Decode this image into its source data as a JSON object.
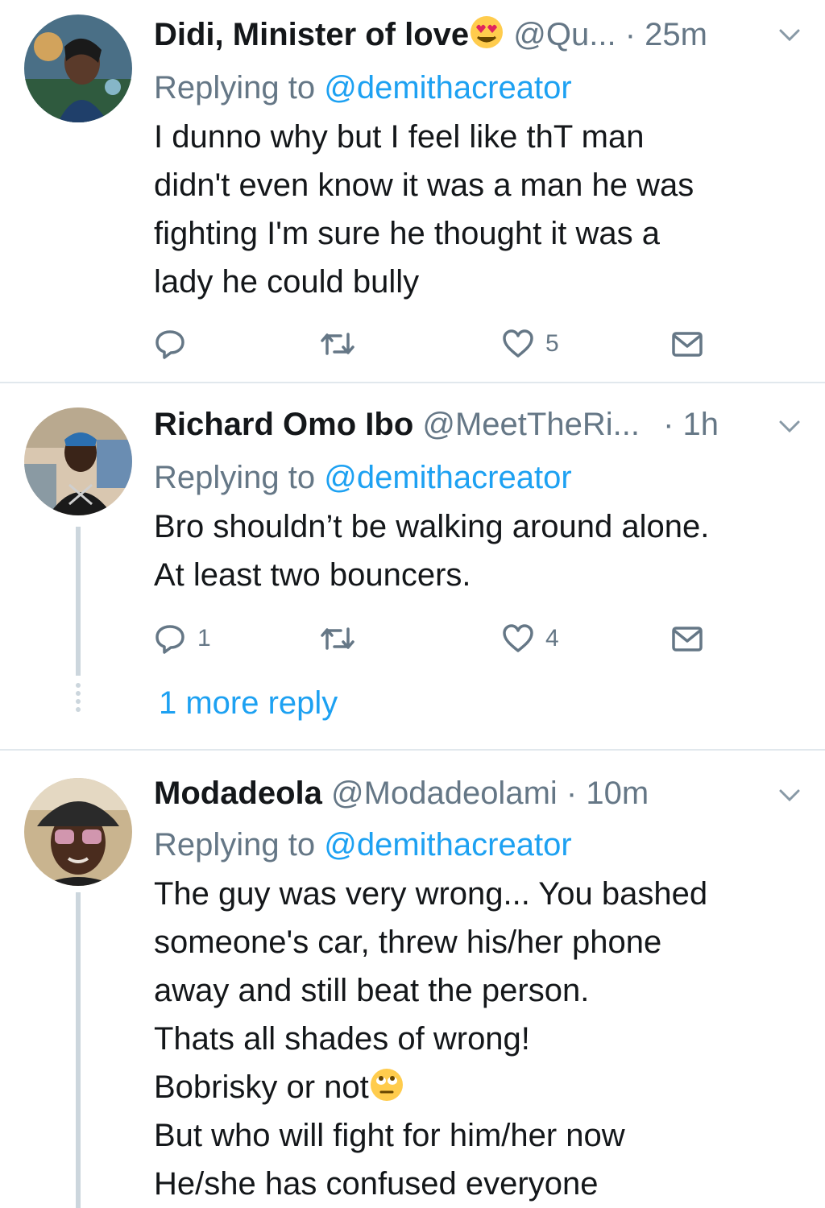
{
  "tweets": [
    {
      "name": "Didi, Minister of love",
      "name_emoji": "heart-eyes-emoji",
      "handle": "@Qu...",
      "time": "· 25m",
      "replying_prefix": "Replying to",
      "replying_to": "@demithacreator",
      "body": [
        "I dunno why but I feel like thT man",
        "didn't even know it was a man he was",
        "fighting I'm sure he thought it was a",
        "lady he could bully"
      ],
      "reply_count": "",
      "retweet_count": "",
      "like_count": "5"
    },
    {
      "name": "Richard Omo Ibo",
      "handle": "@MeetTheRi...",
      "time": "· 1h",
      "replying_prefix": "Replying to",
      "replying_to": "@demithacreator",
      "body": [
        "Bro shouldn’t be walking around alone.",
        "At least two bouncers."
      ],
      "reply_count": "1",
      "retweet_count": "",
      "like_count": "4",
      "more_replies": "1 more reply"
    },
    {
      "name": "Modadeola",
      "handle": "@Modadeolami",
      "time": "· 10m",
      "replying_prefix": "Replying to",
      "replying_to": "@demithacreator",
      "body": [
        "The guy was very wrong... You bashed",
        "someone's car, threw his/her phone",
        "away and still beat the person.",
        "Thats all shades of wrong!",
        "Bobrisky or not",
        "But who will fight for him/her now",
        "He/she has confused everyone"
      ],
      "body_emoji_line": 4,
      "body_emoji": "eye-roll-emoji"
    }
  ],
  "colors": {
    "text": "#14171a",
    "secondary": "#657786",
    "link": "#1da1f2",
    "divider": "#e1e8ed",
    "thread": "#ccd6dd"
  }
}
